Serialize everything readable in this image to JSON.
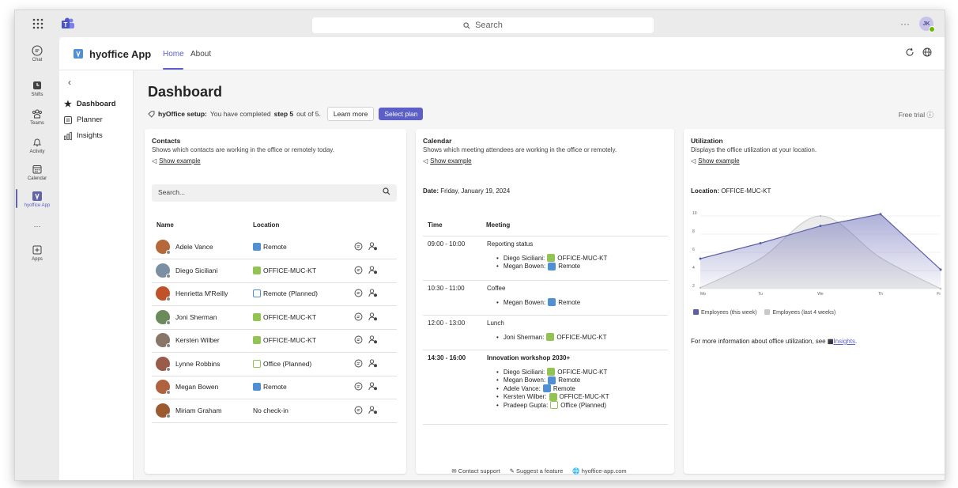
{
  "topbar": {
    "search_placeholder": "Search",
    "more": "···",
    "user_initials": "JK"
  },
  "rail": [
    {
      "label": "Chat",
      "icon": "chat-icon"
    },
    {
      "label": "Shifts",
      "icon": "shifts-icon"
    },
    {
      "label": "Teams",
      "icon": "teams-icon"
    },
    {
      "label": "Activity",
      "icon": "bell-icon"
    },
    {
      "label": "Calendar",
      "icon": "calendar-icon"
    },
    {
      "label": "hyoffice App",
      "icon": "hyoffice-icon"
    },
    {
      "label": "···",
      "icon": "more-icon"
    },
    {
      "label": "Apps",
      "icon": "plus-box-icon"
    }
  ],
  "app": {
    "name": "hyoffice App",
    "tabs": [
      "Home",
      "About"
    ],
    "active_tab": "Home"
  },
  "sidenav": {
    "items": [
      "Dashboard",
      "Planner",
      "Insights"
    ],
    "active": "Dashboard"
  },
  "page": {
    "title": "Dashboard",
    "setup_label": "hyOffice setup:",
    "setup_text_1": "You have completed",
    "setup_step": "step 5",
    "setup_text_2": "out of 5.",
    "learn_more": "Learn more",
    "select_plan": "Select plan",
    "free_trial": "Free trial ⓘ"
  },
  "contacts": {
    "title": "Contacts",
    "subtitle": "Shows which contacts are working in the office or remotely today.",
    "show_example": "Show example",
    "search_placeholder": "Search...",
    "col_name": "Name",
    "col_location": "Location",
    "rows": [
      {
        "name": "Adele Vance",
        "location": "Remote",
        "tag": "remote",
        "avatar_color": "#b5683a"
      },
      {
        "name": "Diego Siciliani",
        "location": "OFFICE-MUC-KT",
        "tag": "office",
        "avatar_color": "#7a8fa3"
      },
      {
        "name": "Henrietta M'Reilly",
        "location": "Remote (Planned)",
        "tag": "remote-planned",
        "avatar_color": "#c0522b"
      },
      {
        "name": "Joni Sherman",
        "location": "OFFICE-MUC-KT",
        "tag": "office",
        "avatar_color": "#6b8a5a"
      },
      {
        "name": "Kersten Wilber",
        "location": "OFFICE-MUC-KT",
        "tag": "office",
        "avatar_color": "#8a7666"
      },
      {
        "name": "Lynne Robbins",
        "location": "Office (Planned)",
        "tag": "office-planned",
        "avatar_color": "#9a5b4a"
      },
      {
        "name": "Megan Bowen",
        "location": "Remote",
        "tag": "remote",
        "avatar_color": "#b0623f"
      },
      {
        "name": "Miriam Graham",
        "location": "No check-in",
        "tag": "none",
        "avatar_color": "#9c5a30"
      }
    ]
  },
  "calendar": {
    "title": "Calendar",
    "subtitle": "Shows which meeting attendees are working in the office or remotely.",
    "show_example": "Show example",
    "date_label": "Date:",
    "date_value": "Friday, January 19, 2024",
    "col_time": "Time",
    "col_meeting": "Meeting",
    "meetings": [
      {
        "time": "09:00 - 10:00",
        "title": "Reporting status",
        "bold": false,
        "attendees": [
          {
            "name": "Diego Siciliani:",
            "location": "OFFICE-MUC-KT",
            "tag": "office"
          },
          {
            "name": "Megan Bowen:",
            "location": "Remote",
            "tag": "remote"
          }
        ]
      },
      {
        "time": "10:30 - 11:00",
        "title": "Coffee",
        "bold": false,
        "attendees": [
          {
            "name": "Megan Bowen:",
            "location": "Remote",
            "tag": "remote"
          }
        ]
      },
      {
        "time": "12:00 - 13:00",
        "title": "Lunch",
        "bold": false,
        "attendees": [
          {
            "name": "Joni Sherman:",
            "location": "OFFICE-MUC-KT",
            "tag": "office"
          }
        ]
      },
      {
        "time": "14:30 - 16:00",
        "title": "Innovation workshop 2030+",
        "bold": true,
        "attendees": [
          {
            "name": "Diego Siciliani:",
            "location": "OFFICE-MUC-KT",
            "tag": "office"
          },
          {
            "name": "Megan Bowen:",
            "location": "Remote",
            "tag": "remote"
          },
          {
            "name": "Adele Vance:",
            "location": "Remote",
            "tag": "remote"
          },
          {
            "name": "Kersten Wilber:",
            "location": "OFFICE-MUC-KT",
            "tag": "office"
          },
          {
            "name": "Pradeep Gupta:",
            "location": "Office (Planned)",
            "tag": "office-planned"
          }
        ]
      }
    ]
  },
  "utilization": {
    "title": "Utilization",
    "subtitle": "Displays the office utilization at your location.",
    "show_example": "Show example",
    "location_label": "Location:",
    "location_value": "OFFICE-MUC-KT",
    "more_info": "For more information about office utilization, see",
    "insights_link": "Insights",
    "period": "."
  },
  "chart_data": {
    "type": "area",
    "categories": [
      "Mo",
      "Tu",
      "We",
      "Th",
      "Fr"
    ],
    "series": [
      {
        "name": "Employees (this week)",
        "values": [
          5.3,
          7,
          8.9,
          10.2,
          4.1
        ],
        "color": "#5b5fa8"
      },
      {
        "name": "Employees (last 4 weeks)",
        "values": [
          2.1,
          5.3,
          10,
          5.4,
          2
        ],
        "color": "#c8c8c8"
      }
    ],
    "yticks": [
      2,
      4,
      6,
      8,
      10
    ],
    "ylim": [
      2,
      10
    ],
    "grid": true,
    "legend": "bottom-left"
  },
  "footer": {
    "contact": "Contact support",
    "suggest": "Suggest a feature",
    "site": "hyoffice-app.com"
  },
  "colors": {
    "accent": "#5b5fc7",
    "remote": "#4f8fd6",
    "office": "#92c353"
  }
}
